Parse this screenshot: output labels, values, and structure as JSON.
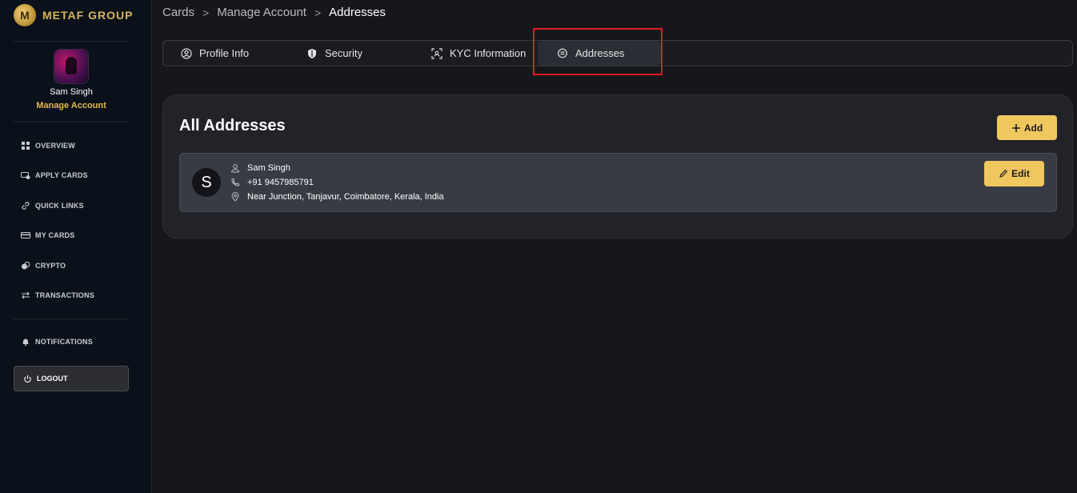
{
  "app": {
    "logo_text": "METAF GROUP",
    "logo_letter": "M"
  },
  "user": {
    "name": "Sam Singh",
    "manage_label": "Manage Account"
  },
  "sidebar": {
    "items": [
      {
        "label": "OVERVIEW",
        "icon": "grid-icon"
      },
      {
        "label": "APPLY CARDS",
        "icon": "cards-icon"
      },
      {
        "label": "QUICK LINKS",
        "icon": "link-icon"
      },
      {
        "label": "MY CARDS",
        "icon": "card-icon"
      },
      {
        "label": "CRYPTO",
        "icon": "crypto-icon"
      },
      {
        "label": "TRANSACTIONS",
        "icon": "arrows-icon"
      }
    ],
    "notifications": "NOTIFICATIONS",
    "logout": "LOGOUT"
  },
  "breadcrumb": {
    "items": [
      "Cards",
      "Manage Account",
      "Addresses"
    ],
    "separator": ">"
  },
  "tabs": [
    {
      "label": "Profile Info",
      "icon": "user-circle-icon",
      "active": false
    },
    {
      "label": "Security",
      "icon": "shield-icon",
      "active": false
    },
    {
      "label": "KYC Information",
      "icon": "scan-icon",
      "active": false
    },
    {
      "label": "Addresses",
      "icon": "location-icon",
      "active": true
    }
  ],
  "addresses": {
    "title": "All Addresses",
    "add_label": "Add",
    "list": [
      {
        "initial": "S",
        "name": "Sam Singh",
        "phone": "+91 9457985791",
        "address": "Near Junction, Tanjavur, Coimbatore, Kerala, India",
        "edit_label": "Edit"
      }
    ]
  },
  "colors": {
    "accent": "#f0c75e",
    "highlight": "#e11d24",
    "sidebar_bg": "#0b111a",
    "main_bg": "#16171c"
  }
}
